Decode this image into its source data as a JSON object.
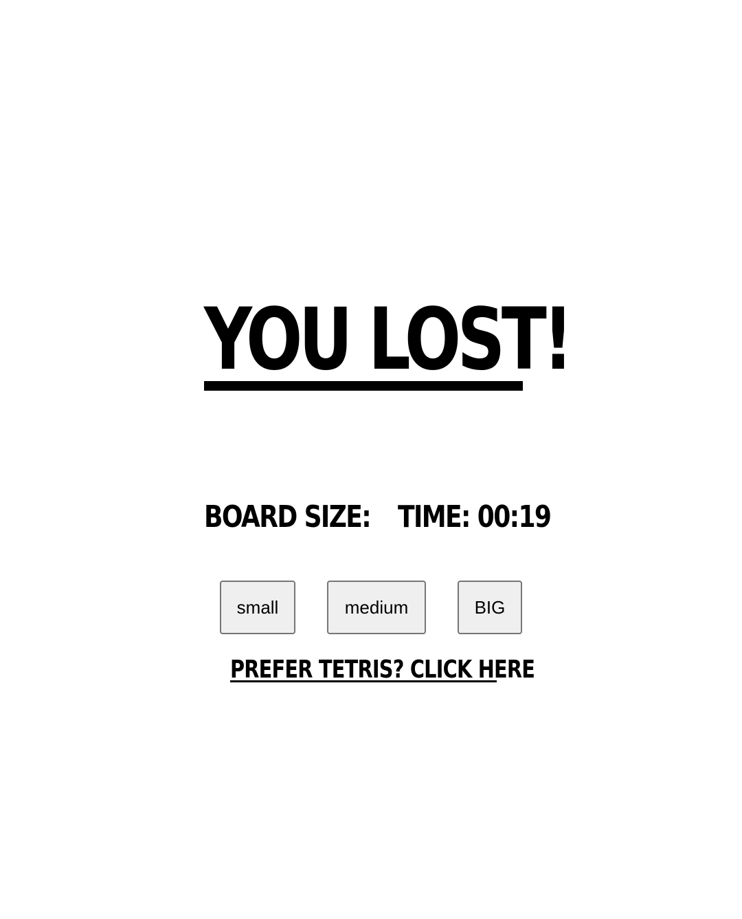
{
  "game_over": {
    "title": "YOU LOST!"
  },
  "stats": {
    "board_size_label": "BOARD SIZE:",
    "time_label": "TIME: 00:19"
  },
  "board_size_options": {
    "small": "small",
    "medium": "medium",
    "big": "BIG"
  },
  "alternate_game_link": "PREFER TETRIS? CLICK HERE",
  "colors": {
    "background": "#ffffff",
    "text": "#000000",
    "button_background": "#efefef",
    "button_border": "#767676"
  }
}
